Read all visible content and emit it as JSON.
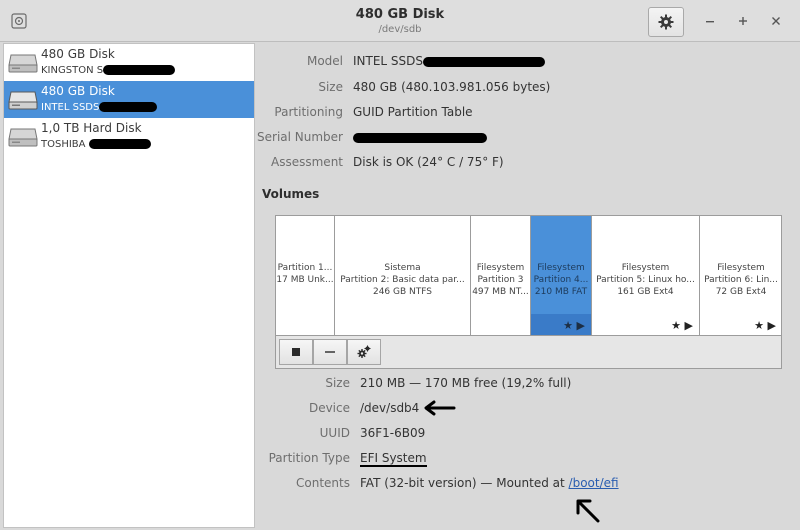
{
  "window": {
    "title": "480 GB Disk",
    "subtitle": "/dev/sdb"
  },
  "drives": [
    {
      "name": "480 GB Disk",
      "sub": "KINGSTON S"
    },
    {
      "name": "480 GB Disk",
      "sub": "INTEL SSDS"
    },
    {
      "name": "1,0 TB Hard Disk",
      "sub": "TOSHIBA "
    }
  ],
  "disk_info": {
    "model_label": "Model",
    "model_value": "INTEL SSDS",
    "size_label": "Size",
    "size_value": "480 GB (480.103.981.056 bytes)",
    "partitioning_label": "Partitioning",
    "partitioning_value": "GUID Partition Table",
    "serial_label": "Serial Number",
    "serial_value": "",
    "assessment_label": "Assessment",
    "assessment_value": "Disk is OK (24° C / 75° F)"
  },
  "volumes_title": "Volumes",
  "volumes": [
    {
      "line1": "Partition 1...",
      "line2": "17 MB Unk...",
      "line3": ""
    },
    {
      "line1": "Sistema",
      "line2": "Partition 2: Basic data par...",
      "line3": "246 GB NTFS"
    },
    {
      "line1": "Filesystem",
      "line2": "Partition 3",
      "line3": "497 MB NT..."
    },
    {
      "line1": "Filesystem",
      "line2": "Partition 4...",
      "line3": "210 MB FAT"
    },
    {
      "line1": "Filesystem",
      "line2": "Partition 5: Linux ho...",
      "line3": "161 GB Ext4"
    },
    {
      "line1": "Filesystem",
      "line2": "Partition 6: Lin...",
      "line3": "72 GB Ext4"
    }
  ],
  "partition_info": {
    "size_label": "Size",
    "size_value": "210 MB — 170 MB free (19,2% full)",
    "device_label": "Device",
    "device_value": "/dev/sdb4",
    "uuid_label": "UUID",
    "uuid_value": "36F1-6B09",
    "type_label": "Partition Type",
    "type_value": "EFI System",
    "contents_label": "Contents",
    "contents_value": "FAT (32-bit version) — Mounted at ",
    "mount_link": "/boot/efi"
  },
  "icons": {
    "app": "disks-app-icon",
    "gear": "gear-icon",
    "minimize": "minimize-icon",
    "maximize": "maximize-icon",
    "close": "close-icon",
    "stop": "stop-icon",
    "remove": "minus-icon",
    "settings": "gears-icon"
  },
  "colors": {
    "selection": "#4a90d9",
    "background": "#d9d9d9"
  }
}
